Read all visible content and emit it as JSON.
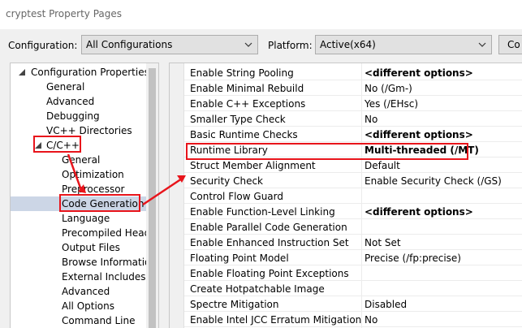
{
  "window": {
    "title": "cryptest Property Pages"
  },
  "config_bar": {
    "configuration_label": "Configuration:",
    "configuration_value": "All Configurations",
    "platform_label": "Platform:",
    "platform_value": "Active(x64)",
    "button_label": "Co"
  },
  "tree": {
    "items": [
      {
        "label": "Configuration Properties",
        "expanded": true
      },
      {
        "label": "General"
      },
      {
        "label": "Advanced"
      },
      {
        "label": "Debugging"
      },
      {
        "label": "VC++ Directories"
      },
      {
        "label": "C/C++",
        "expanded": true
      },
      {
        "label": "General"
      },
      {
        "label": "Optimization"
      },
      {
        "label": "Preprocessor"
      },
      {
        "label": "Code Generation",
        "selected": true
      },
      {
        "label": "Language"
      },
      {
        "label": "Precompiled Heade"
      },
      {
        "label": "Output Files"
      },
      {
        "label": "Browse Information"
      },
      {
        "label": "External Includes"
      },
      {
        "label": "Advanced"
      },
      {
        "label": "All Options"
      },
      {
        "label": "Command Line"
      }
    ]
  },
  "properties": [
    {
      "name": "Enable String Pooling",
      "value": "<different options>",
      "bold": true
    },
    {
      "name": "Enable Minimal Rebuild",
      "value": "No (/Gm-)"
    },
    {
      "name": "Enable C++ Exceptions",
      "value": "Yes (/EHsc)"
    },
    {
      "name": "Smaller Type Check",
      "value": "No"
    },
    {
      "name": "Basic Runtime Checks",
      "value": "<different options>",
      "bold": true
    },
    {
      "name": "Runtime Library",
      "value": "Multi-threaded (/MT)",
      "bold": true
    },
    {
      "name": "Struct Member Alignment",
      "value": "Default"
    },
    {
      "name": "Security Check",
      "value": "Enable Security Check (/GS)"
    },
    {
      "name": "Control Flow Guard",
      "value": ""
    },
    {
      "name": "Enable Function-Level Linking",
      "value": "<different options>",
      "bold": true
    },
    {
      "name": "Enable Parallel Code Generation",
      "value": ""
    },
    {
      "name": "Enable Enhanced Instruction Set",
      "value": "Not Set"
    },
    {
      "name": "Floating Point Model",
      "value": "Precise (/fp:precise)"
    },
    {
      "name": "Enable Floating Point Exceptions",
      "value": ""
    },
    {
      "name": "Create Hotpatchable Image",
      "value": ""
    },
    {
      "name": "Spectre Mitigation",
      "value": "Disabled"
    },
    {
      "name": "Enable Intel JCC Erratum Mitigation",
      "value": "No"
    }
  ],
  "colors": {
    "annotation": "#e8141b",
    "selection": "#ccd6e6"
  }
}
